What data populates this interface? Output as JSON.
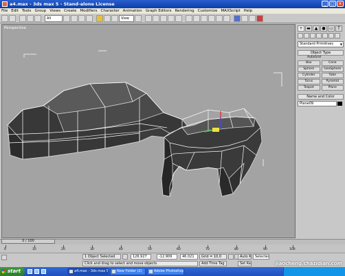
{
  "window": {
    "title": "a4.max - 3ds max 5 - Stand-alone License"
  },
  "menu": [
    "File",
    "Edit",
    "Tools",
    "Group",
    "Views",
    "Create",
    "Modifiers",
    "Character",
    "Animation",
    "Graph Editors",
    "Rendering",
    "Customize",
    "MAXScript",
    "Help"
  ],
  "toolbar": {
    "selection_filter": "All",
    "reference_coord": "View"
  },
  "viewport": {
    "label": "Perspective",
    "background": "#a3a3a3"
  },
  "command_panel": {
    "tabs": [
      "+",
      "▬",
      "▲",
      "●",
      "▭",
      "T"
    ],
    "category_dropdown": "Standard Primitives",
    "object_type_header": "Object Type",
    "autogrid_label": "AutoGrid",
    "buttons": [
      "Box",
      "Cone",
      "Sphere",
      "GeoSphere",
      "Cylinder",
      "Tube",
      "Torus",
      "Pyramid",
      "Teapot",
      "Plane"
    ],
    "name_color_header": "Name and Color",
    "object_name": "Plane09"
  },
  "timeline": {
    "slider_label": "0 / 100",
    "ticks": [
      "0",
      "10",
      "20",
      "30",
      "40",
      "50",
      "60",
      "70",
      "80",
      "90",
      "100"
    ]
  },
  "status": {
    "selection_info": "1 Object Selected",
    "prompt": "Click and drag to select and move objects",
    "x_value": "126.927",
    "y_value": "-12.909",
    "z_value": "46.021",
    "grid": "Grid = 10.0",
    "add_time_tag": "Add Time Tag",
    "auto_key": "Auto Key",
    "auto_key_mode": "Selected",
    "set_key": "Set Key"
  },
  "taskbar": {
    "start_label": "start",
    "tasks": [
      "a4.max - 3ds max 5 - ...",
      "New Folder (2)",
      "Adobe Photoshop"
    ]
  },
  "watermark": "jiaocheng.chazidian.com"
}
